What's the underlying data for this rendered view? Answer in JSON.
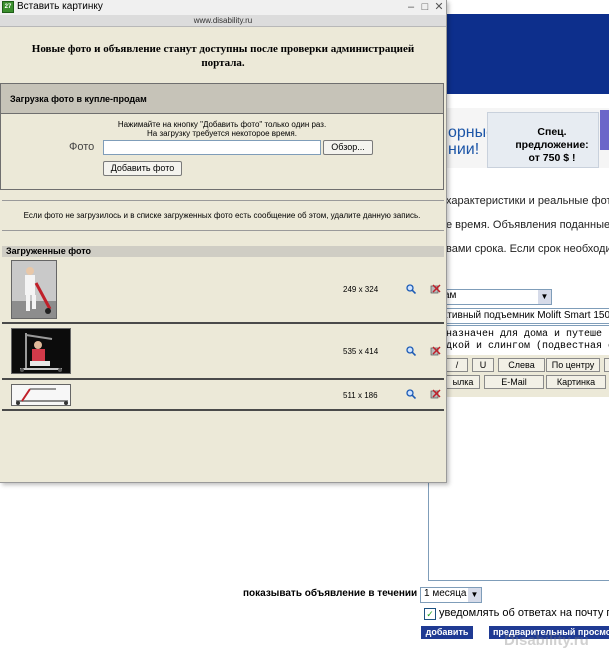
{
  "popup": {
    "window_title": "Вставить картинку",
    "url": "www.disability.ru",
    "notice": "Новые фото и объявление станут доступны после проверки администрацией портала.",
    "upload": {
      "header": "Загрузка фото в купле-продам",
      "hint_line1": "Нажимайте на кнопку \"Добавить фото\" только один раз.",
      "hint_line2": "На загрузку требуется некоторое время.",
      "photo_label": "Фото",
      "browse_label": "Обзор...",
      "add_photo_label": "Добавить фото"
    },
    "info": "Если фото не загрузилось и в списке загруженных фото есть сообщение об этом, удалите данную запись.",
    "uploaded_header": "Загруженные фото",
    "photos": [
      {
        "dims": "249 x 324"
      },
      {
        "dims": "535 x 414"
      },
      {
        "dims": "511 x 186"
      }
    ]
  },
  "background": {
    "banner_text": "орные\nнии!",
    "banner_offer": "Спец. предложение: от 750 $ !",
    "line1": "характеристики и реальные фото",
    "line2": "е время. Объявления поданные в д",
    "line3": "вами срока. Если срок необходимо",
    "select_value": "ам",
    "title_value": "ативный подъемник Molift Smart 150 (",
    "textarea_line1": "назначен для  дома  и путеше",
    "textarea_line2": "дкой и слингом (подвестная с",
    "toolbar": {
      "row1": [
        "/",
        "U",
        "Слева",
        "По центру"
      ],
      "row2": [
        "ылка",
        "E-Mail",
        "Картинка"
      ]
    },
    "show_label": "показывать объявление в течении",
    "period_value": "1 месяца",
    "notify_label": "уведомлять об ответах на почту по",
    "add_label": "добавить",
    "preview_label": "предварительный просмо",
    "watermark": "Disability.ru"
  }
}
